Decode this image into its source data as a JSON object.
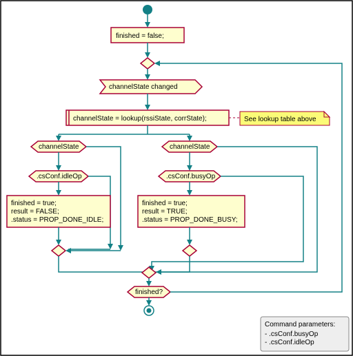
{
  "nodes": {
    "init": "finished = false;",
    "event": "channelState changed",
    "lookup": "channelState = lookup(rssiState, corrState);",
    "note": "See lookup table above",
    "branchLeft": "channelState",
    "branchRight": "channelState",
    "idleOp": ".csConf.idleOp",
    "busyOp": ".csConf.busyOp",
    "idleBody1": "finished = true;",
    "idleBody2": "result = FALSE;",
    "idleBody3": ".status = PROP_DONE_IDLE;",
    "busyBody1": "finished = true;",
    "busyBody2": "result = TRUE;",
    "busyBody3": ".status = PROP_DONE_BUSY;",
    "final": "finished?"
  },
  "params": {
    "title": "Command parameters:",
    "p1": "- .csConf.busyOp",
    "p2": "- .csConf.idleOp"
  }
}
